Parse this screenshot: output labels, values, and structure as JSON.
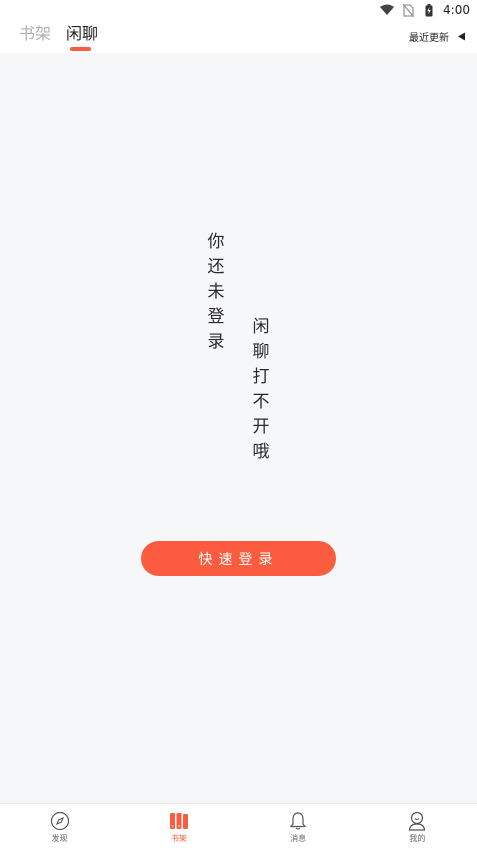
{
  "status_bar": {
    "time": "4:00",
    "icons": [
      "wifi-icon",
      "no-sim-icon",
      "battery-charging-icon"
    ]
  },
  "header": {
    "tabs": [
      {
        "label": "书架",
        "active": false
      },
      {
        "label": "闲聊",
        "active": true
      }
    ],
    "sort_label": "最近更新",
    "sort_icon": "triangle-left-icon"
  },
  "main": {
    "message_line_1": "你还未登录",
    "message_line_2": "闲聊打不开哦",
    "login_button_label": "快速登录"
  },
  "bottom_nav": {
    "items": [
      {
        "label": "发现",
        "icon": "compass-icon",
        "active": false
      },
      {
        "label": "书架",
        "icon": "bookshelf-icon",
        "active": true
      },
      {
        "label": "消息",
        "icon": "bell-icon",
        "active": false
      },
      {
        "label": "我的",
        "icon": "profile-icon",
        "active": false
      }
    ]
  },
  "colors": {
    "accent": "#fb5c3f",
    "background": "#f6f7f9",
    "inactive_tab": "#b0b0b0"
  }
}
